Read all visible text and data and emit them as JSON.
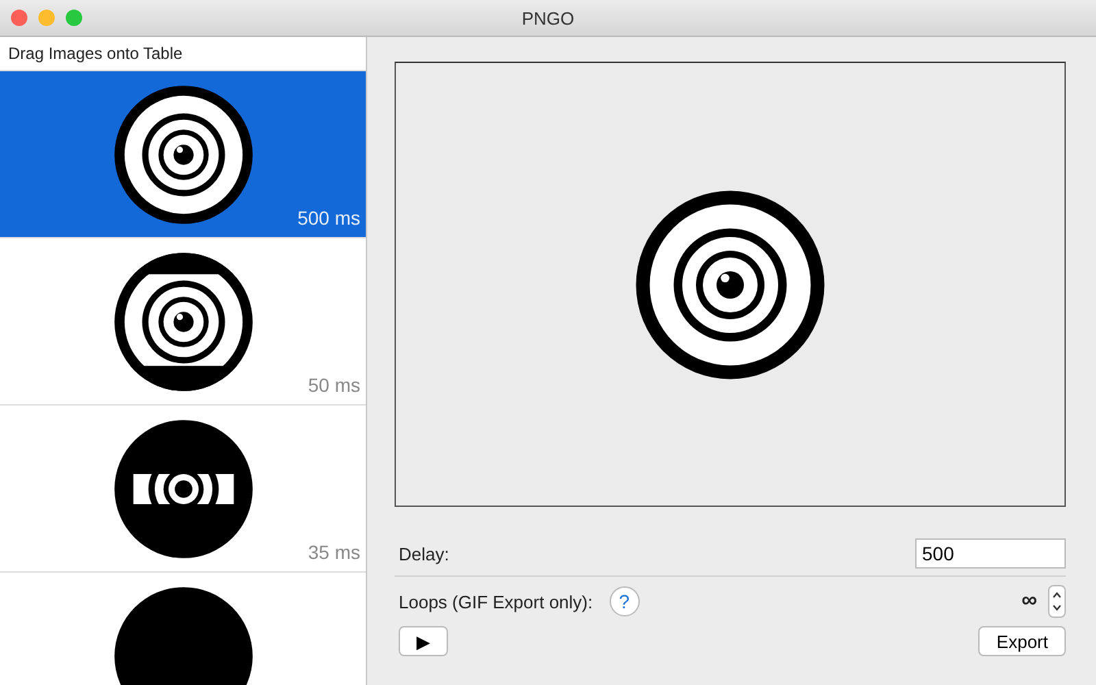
{
  "window": {
    "title": "PNGO"
  },
  "sidebar": {
    "header": "Drag Images onto Table",
    "frames": [
      {
        "kind": "rings",
        "delay": "500 ms",
        "selected": true
      },
      {
        "kind": "banded",
        "delay": "50 ms",
        "selected": false
      },
      {
        "kind": "slit",
        "delay": "35 ms",
        "selected": false
      },
      {
        "kind": "solid",
        "selected": false
      }
    ]
  },
  "preview": {
    "kind": "rings"
  },
  "delay": {
    "label": "Delay:",
    "value": "500"
  },
  "loops": {
    "label": "Loops (GIF Export only):",
    "help": "?",
    "value": "∞"
  },
  "buttons": {
    "play": "▶",
    "export": "Export"
  }
}
